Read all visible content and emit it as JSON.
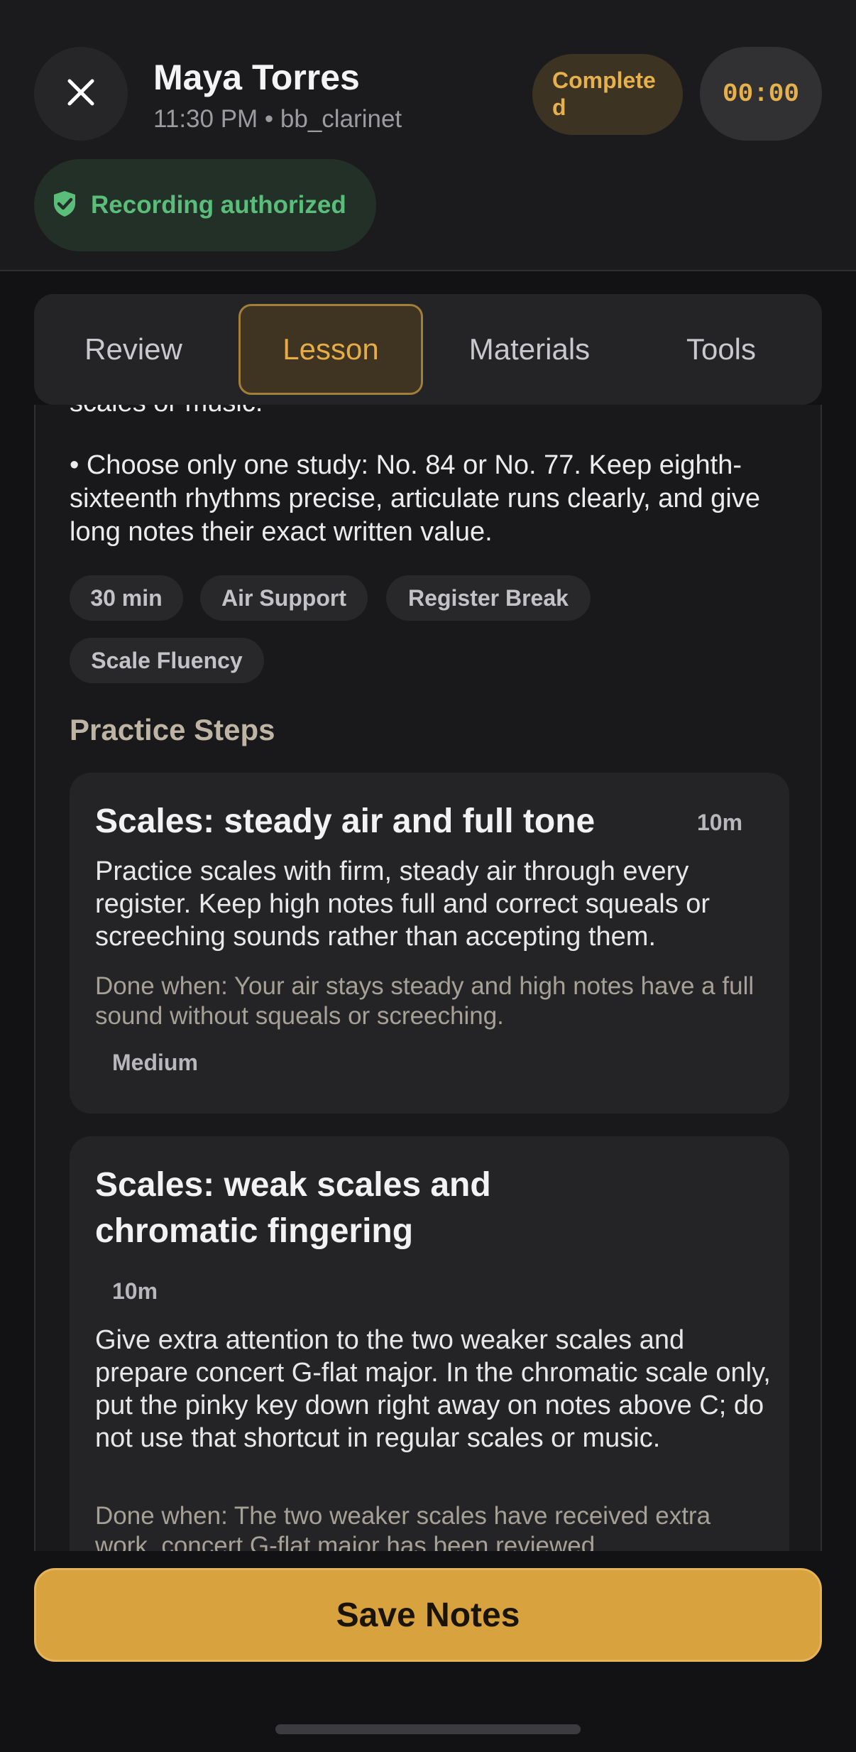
{
  "header": {
    "name": "Maya Torres",
    "meta": "11:30 PM • bb_clarinet",
    "status": "Completed",
    "timer": "00:00",
    "authorization": "Recording authorized"
  },
  "tabs": [
    {
      "label": "Review",
      "active": false
    },
    {
      "label": "Lesson",
      "active": true
    },
    {
      "label": "Materials",
      "active": false
    },
    {
      "label": "Tools",
      "active": false
    }
  ],
  "lesson": {
    "clipped_line": "scales or music.",
    "bullet": "• Choose only one study: No. 84 or No. 77. Keep eighth-sixteenth rhythms precise, articulate runs clearly, and give long notes their exact written value.",
    "chips": [
      "30 min",
      "Air Support",
      "Register Break",
      "Scale Fluency"
    ],
    "section_title": "Practice Steps",
    "steps": [
      {
        "title": "Scales: steady air and full tone",
        "duration": "10m",
        "description": "Practice scales with firm, steady air through every register. Keep high notes full and correct squeals or screeching sounds rather than accepting them.",
        "done_when": "Done when: Your air stays steady and high notes have a full sound without squeals or screeching.",
        "level": "Medium"
      },
      {
        "title": "Scales: weak scales and chromatic fingering",
        "duration": "10m",
        "description": "Give extra attention to the two weaker scales and prepare concert G-flat major. In the chromatic scale only, put the pinky key down right away on notes above C; do not use that shortcut in regular scales or music.",
        "done_when": "Done when: The two weaker scales have received extra work, concert G-flat major has been reviewed"
      }
    ]
  },
  "footer": {
    "save_label": "Save Notes"
  },
  "colors": {
    "accent": "#d8a23f",
    "success": "#5bbd7a",
    "background": "#121214"
  },
  "icons": {
    "close": "close-icon",
    "shield": "shield-check-icon"
  }
}
